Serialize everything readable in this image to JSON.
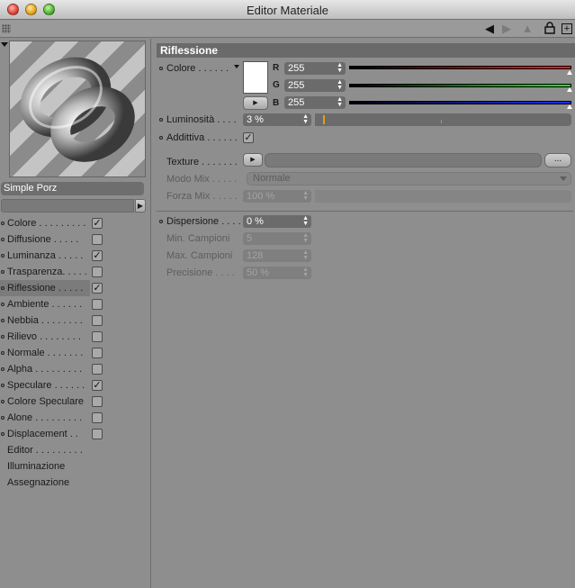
{
  "window": {
    "title": "Editor Materiale"
  },
  "material": {
    "name": "Simple Porz"
  },
  "channels": [
    {
      "label": "Colore . . . . . . . . .",
      "checked": true,
      "selected": false,
      "has_checkbox": true
    },
    {
      "label": "Diffusione . . . . .",
      "checked": false,
      "selected": false,
      "has_checkbox": true
    },
    {
      "label": "Luminanza . . . . .",
      "checked": true,
      "selected": false,
      "has_checkbox": true
    },
    {
      "label": "Trasparenza. . . . .",
      "checked": false,
      "selected": false,
      "has_checkbox": true
    },
    {
      "label": "Riflessione . . . . .",
      "checked": true,
      "selected": true,
      "has_checkbox": true
    },
    {
      "label": "Ambiente . . . . . .",
      "checked": false,
      "selected": false,
      "has_checkbox": true
    },
    {
      "label": "Nebbia . . . . . . . .",
      "checked": false,
      "selected": false,
      "has_checkbox": true
    },
    {
      "label": "Rilievo . . . . . . . .",
      "checked": false,
      "selected": false,
      "has_checkbox": true
    },
    {
      "label": "Normale . . . . . . .",
      "checked": false,
      "selected": false,
      "has_checkbox": true
    },
    {
      "label": "Alpha . . . . . . . . .",
      "checked": false,
      "selected": false,
      "has_checkbox": true
    },
    {
      "label": "Speculare . . . . . .",
      "checked": true,
      "selected": false,
      "has_checkbox": true
    },
    {
      "label": "Colore Speculare",
      "checked": false,
      "selected": false,
      "has_checkbox": true
    },
    {
      "label": "Alone . . . . . . . . .",
      "checked": false,
      "selected": false,
      "has_checkbox": true
    },
    {
      "label": "Displacement . .",
      "checked": false,
      "selected": false,
      "has_checkbox": true
    },
    {
      "label": "Editor . . . . . . . . .",
      "has_checkbox": false
    },
    {
      "label": "Illuminazione",
      "has_checkbox": false
    },
    {
      "label": "Assegnazione",
      "has_checkbox": false
    }
  ],
  "reflection": {
    "header": "Riflessione",
    "color_label": "Colore . . . . . .",
    "swatch_color": "#ffffff",
    "r_label": "R",
    "r_value": "255",
    "g_label": "G",
    "g_value": "255",
    "b_label": "B",
    "b_value": "255",
    "luminosity_label": "Luminosità . . . .",
    "luminosity_value": "3 %",
    "luminosity_fraction": 0.03,
    "additive_label": "Addittiva . . . . . .",
    "additive_checked": true,
    "texture_label": "Texture . . . . . . .",
    "texture_button": "...",
    "mix_mode_label": "Modo Mix . . . . .",
    "mix_mode_value": "Normale",
    "mix_strength_label": "Forza Mix . . . . .",
    "mix_strength_value": "100 %",
    "dispersion_label": "Dispersione . . . .",
    "dispersion_value": "0 %",
    "min_samples_label": "Min. Campioni",
    "min_samples_value": "5",
    "max_samples_label": "Max. Campioni",
    "max_samples_value": "128",
    "precision_label": "Precisione . . . .",
    "precision_value": "50 %"
  },
  "colors": {
    "red": "#ff2020",
    "green": "#22ee22",
    "blue": "#2030ff",
    "accent": "#e3a010"
  },
  "icons": {
    "back": "triangle-left-icon",
    "forward": "triangle-right-icon",
    "up": "up-arrow-icon",
    "lock": "lock-icon",
    "add": "plus-box-icon"
  }
}
